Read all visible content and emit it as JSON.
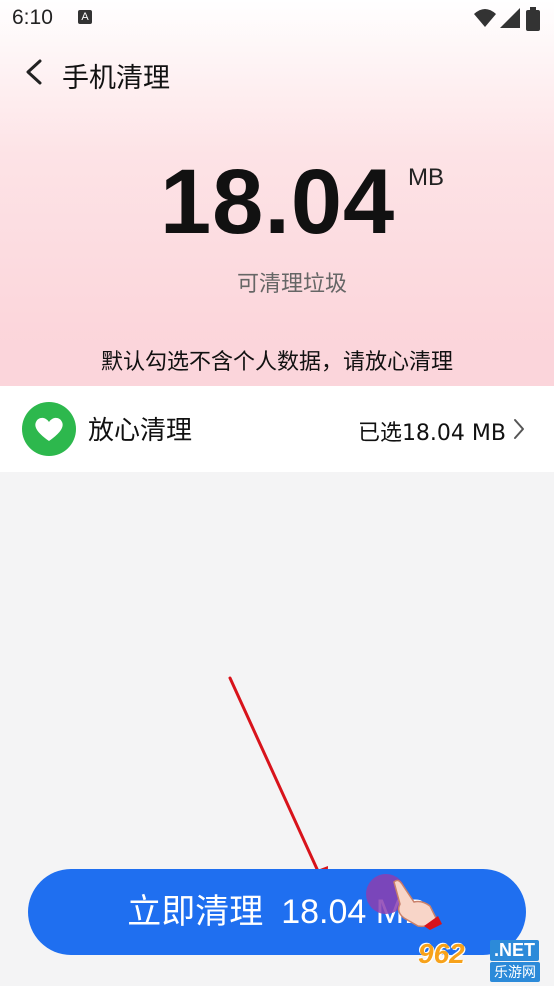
{
  "status_bar": {
    "time": "6:10",
    "notification_letter": "A",
    "icons": [
      "wifi-icon",
      "signal-icon",
      "battery-icon"
    ]
  },
  "header": {
    "back_icon": "chevron-left-icon",
    "title": "手机清理"
  },
  "summary": {
    "size_value": "18.04",
    "size_unit": "MB",
    "size_label": "可清理垃圾"
  },
  "notice": "默认勾选不含个人数据，请放心清理",
  "list": {
    "icon": "heart-icon",
    "label": "放心清理",
    "selected_text": "已选18.04 MB",
    "chevron": "chevron-right-icon"
  },
  "action": {
    "label": "立即清理",
    "amount": "18.04 MB"
  },
  "watermark": {
    "number": "962",
    "domain": ".NET",
    "chinese": "乐游网"
  },
  "colors": {
    "accent": "#1f6ff0",
    "header_pink": "#fbd5db",
    "heart_green": "#2db84d",
    "annotation_red": "#d8131b"
  }
}
